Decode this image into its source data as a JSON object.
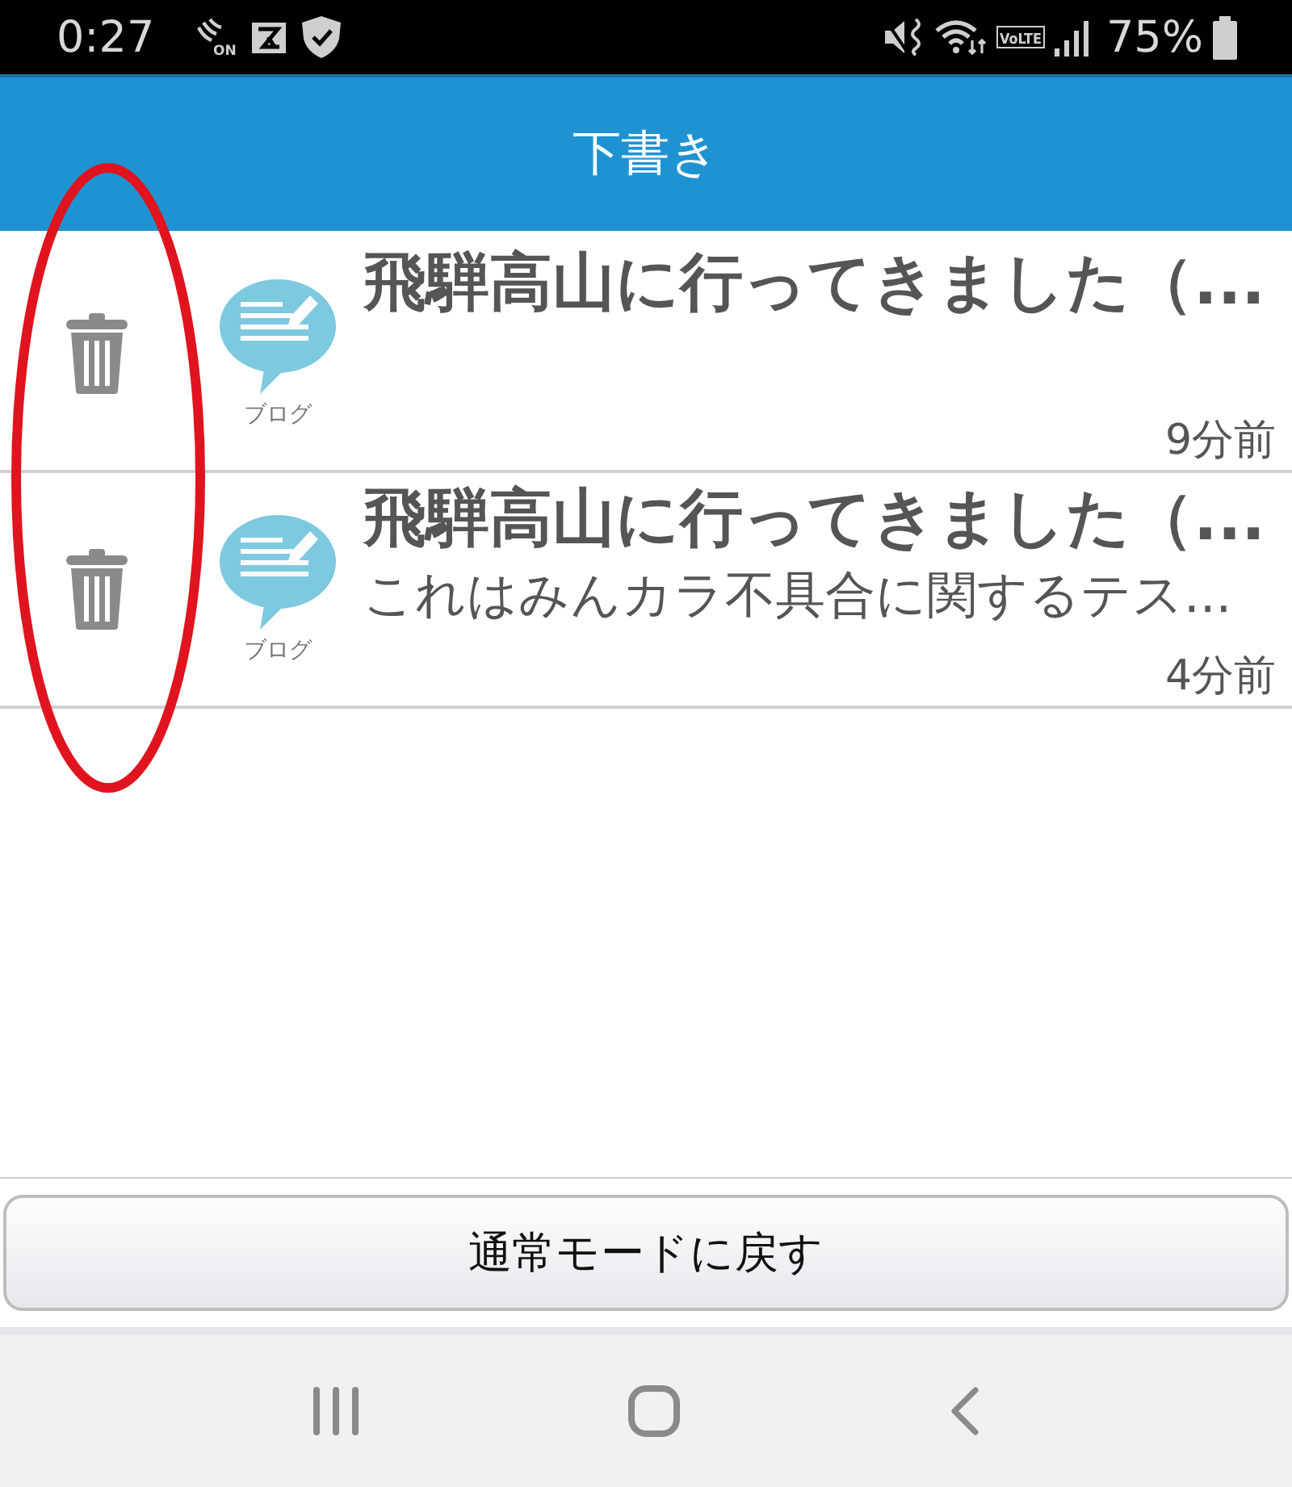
{
  "status_bar": {
    "time": "0:27",
    "nfc_badge": "ON",
    "volte_badge": "VoLTE",
    "battery": "75%"
  },
  "header": {
    "title": "下書き"
  },
  "drafts": [
    {
      "title": "飛騨高山に行ってきました（...",
      "category": "ブログ",
      "time": "9分前"
    },
    {
      "title": "飛騨高山に行ってきました（...",
      "snippet": "これはみんカラ不具合に関するテス...",
      "category": "ブログ",
      "time": "4分前"
    }
  ],
  "delete_column_circled": true,
  "footer_button": {
    "label": "通常モードに戻す"
  },
  "nav_bar": {
    "buttons": [
      {
        "kind": "recents"
      },
      {
        "kind": "home"
      },
      {
        "kind": "back"
      }
    ]
  }
}
